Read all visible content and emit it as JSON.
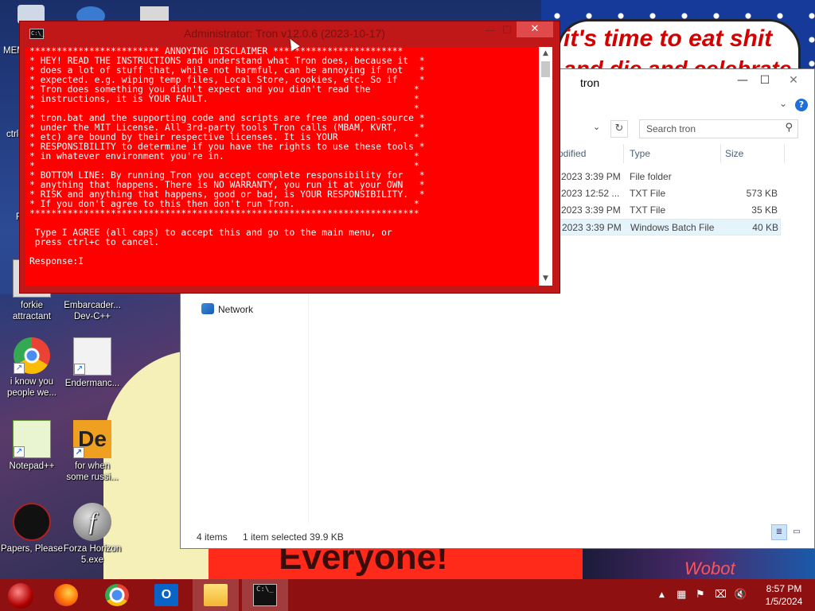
{
  "wallpaper": {
    "bubble_line1": "it's time to eat shit",
    "bubble_line2": "and die and celebrate",
    "banner_text": "Everyone!",
    "right_text": "Wobot"
  },
  "desktop_icons": [
    {
      "label1": "forkie",
      "label2": "attractant"
    },
    {
      "label1": "Embarcader...",
      "label2": "Dev-C++"
    },
    {
      "label1": "i know you",
      "label2": "people we..."
    },
    {
      "label1": "Endermanc...",
      "label2": ""
    },
    {
      "label1": "Notepad++",
      "label2": ""
    },
    {
      "label1": "for when",
      "label2": "some russi..."
    },
    {
      "label1": "Papers, Please",
      "label2": ""
    },
    {
      "label1": "Forza Horizon",
      "label2": "5.exe"
    }
  ],
  "partial_labels": {
    "mem": "MEM",
    "ctrl": "ctrl-",
    "f": "F"
  },
  "explorer": {
    "title": "tron",
    "search_placeholder": "Search tron",
    "columns": {
      "modified": "odified",
      "type": "Type",
      "size": "Size"
    },
    "rows": [
      {
        "date": "2023 3:39 PM",
        "type": "File folder",
        "size": ""
      },
      {
        "date": "2023 12:52 ...",
        "type": "TXT File",
        "size": "573 KB"
      },
      {
        "date": "2023 3:39 PM",
        "type": "TXT File",
        "size": "35 KB"
      },
      {
        "date": "2023 3:39 PM",
        "type": "Windows Batch File",
        "size": "40 KB"
      }
    ],
    "nav_network": "Network",
    "status_items": "4 items",
    "status_selected": "1 item selected  39.9 KB"
  },
  "console": {
    "title": "Administrator:  Tron v12.0.6 (2023-10-17)",
    "close_glyph": "✕",
    "lines": [
      "************************ ANNOYING DISCLAIMER ************************",
      "* HEY! READ THE INSTRUCTIONS and understand what Tron does, because it  *",
      "* does a lot of stuff that, while not harmful, can be annoying if not   *",
      "* expected. e.g. wiping temp files, Local Store, cookies, etc. So if    *",
      "* Tron does something you didn't expect and you didn't read the        *",
      "* instructions, it is YOUR FAULT.                                      *",
      "*                                                                      *",
      "* tron.bat and the supporting code and scripts are free and open-source *",
      "* under the MIT License. All 3rd-party tools Tron calls (MBAM, KVRT,    *",
      "* etc) are bound by their respective licenses. It is YOUR              *",
      "* RESPONSIBILITY to determine if you have the rights to use these tools *",
      "* in whatever environment you're in.                                   *",
      "*                                                                      *",
      "* BOTTOM LINE: By running Tron you accept complete responsibility for   *",
      "* anything that happens. There is NO WARRANTY, you run it at your OWN   *",
      "* RISK and anything that happens, good or bad, is YOUR RESPONSIBILITY.  *",
      "* If you don't agree to this then don't run Tron.                      *",
      "************************************************************************",
      "",
      " Type I AGREE (all caps) to accept this and go to the main menu, or",
      " press ctrl+c to cancel.",
      "",
      "Response:I"
    ]
  },
  "taskbar": {
    "time": "8:57 PM",
    "date": "1/5/2024",
    "outlook_letter": "O"
  },
  "colors": {
    "console_bg": "#ff0000",
    "taskbar_bg": "#8e1010",
    "console_frame": "#c01818"
  }
}
